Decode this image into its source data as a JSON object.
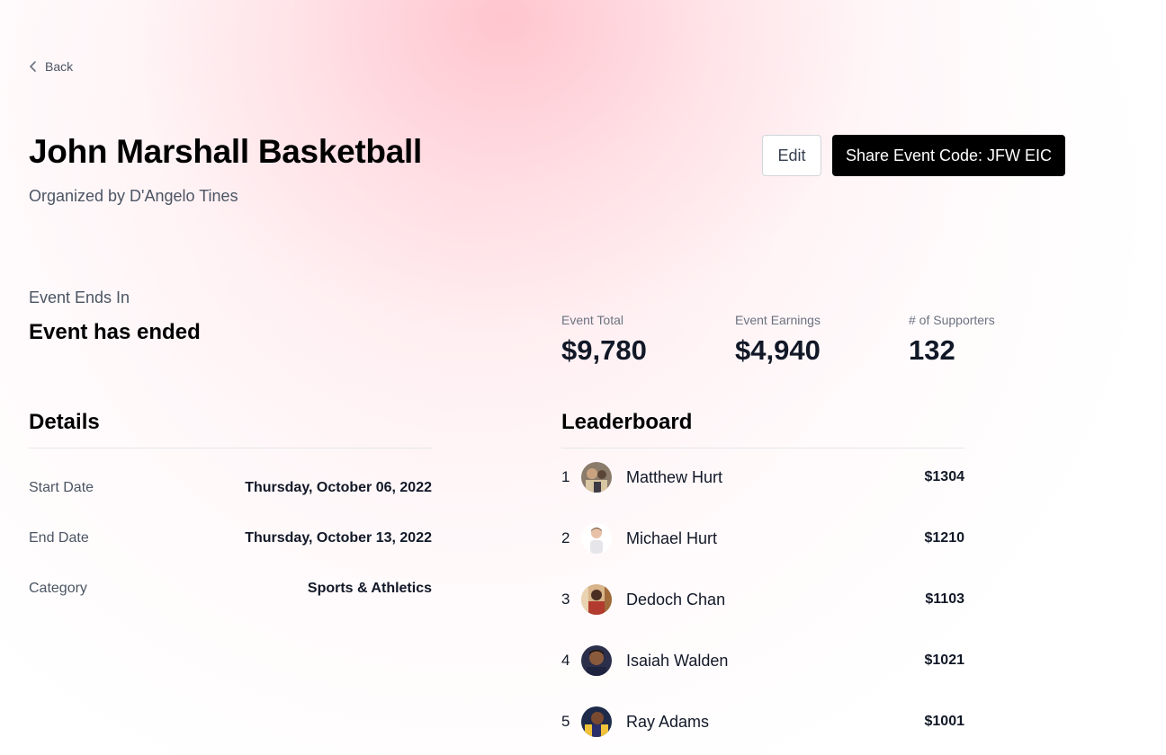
{
  "nav": {
    "back_label": "Back"
  },
  "event": {
    "title": "John Marshall Basketball",
    "organizer": "Organized by D'Angelo Tines"
  },
  "actions": {
    "edit_label": "Edit",
    "share_label": "Share Event Code: JFW EIC"
  },
  "countdown": {
    "label": "Event Ends In",
    "value": "Event has ended"
  },
  "stats": [
    {
      "label": "Event Total",
      "value": "$9,780"
    },
    {
      "label": "Event Earnings",
      "value": "$4,940"
    },
    {
      "label": "# of Supporters",
      "value": "132"
    }
  ],
  "details": {
    "title": "Details",
    "rows": [
      {
        "label": "Start Date",
        "value": "Thursday, October 06, 2022"
      },
      {
        "label": "End Date",
        "value": "Thursday, October 13, 2022"
      },
      {
        "label": "Category",
        "value": "Sports & Athletics"
      }
    ]
  },
  "leaderboard": {
    "title": "Leaderboard",
    "entries": [
      {
        "rank": "1",
        "name": "Matthew Hurt",
        "amount": "$1304"
      },
      {
        "rank": "2",
        "name": "Michael Hurt",
        "amount": "$1210"
      },
      {
        "rank": "3",
        "name": "Dedoch Chan",
        "amount": "$1103"
      },
      {
        "rank": "4",
        "name": "Isaiah Walden",
        "amount": "$1021"
      },
      {
        "rank": "5",
        "name": "Ray Adams",
        "amount": "$1001"
      }
    ]
  },
  "colors": {
    "primary_button": "#000000",
    "accent_glow": "#ffc0cb",
    "muted_text": "#4b5563"
  },
  "icons": {
    "back": "chevron-left-icon"
  }
}
